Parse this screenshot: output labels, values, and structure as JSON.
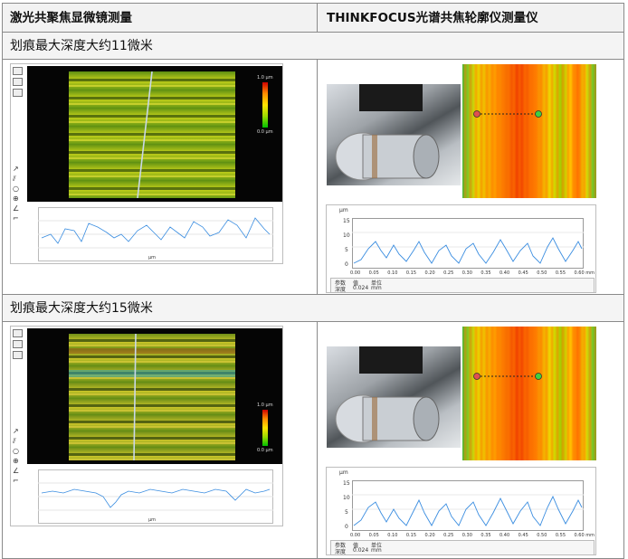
{
  "header": {
    "left": "激光共聚焦显微镜测量",
    "right": "THINKFOCUS光谱共焦轮廓仪测量仪"
  },
  "rows": [
    {
      "caption": "划痕最大深度大约11微米",
      "legend_unit": "1.0 µm",
      "legend_bottom": "0.0 µm",
      "profile_x_label": "µm",
      "chart": {
        "unit": "µm",
        "yticks": [
          "15",
          "10",
          "5",
          "0"
        ],
        "xticks": [
          "0.00",
          "0.05",
          "0.10",
          "0.15",
          "0.20",
          "0.25",
          "0.30",
          "0.35",
          "0.40",
          "0.45",
          "0.50",
          "0.55",
          "0.60 mm"
        ],
        "table": {
          "h1": "参数",
          "h2": "值",
          "h3": "单位",
          "r1": "深度",
          "r2": "0.024",
          "r3": "mm"
        }
      }
    },
    {
      "caption": "划痕最大深度大约15微米",
      "legend_unit": "1.0 µm",
      "legend_bottom": "0.0 µm",
      "profile_x_label": "µm",
      "chart": {
        "unit": "µm",
        "yticks": [
          "15",
          "10",
          "5",
          "0"
        ],
        "xticks": [
          "0.00",
          "0.05",
          "0.10",
          "0.15",
          "0.20",
          "0.25",
          "0.30",
          "0.35",
          "0.40",
          "0.45",
          "0.50",
          "0.55",
          "0.60 mm"
        ],
        "table": {
          "h1": "参数",
          "h2": "值",
          "h3": "单位",
          "r1": "深度",
          "r2": "0.024",
          "r3": "mm"
        }
      }
    }
  ],
  "colors": {
    "line": "#3a8de0",
    "marker_left": "#e05050",
    "marker_right": "#40d040",
    "border": "#8a8a8a"
  }
}
